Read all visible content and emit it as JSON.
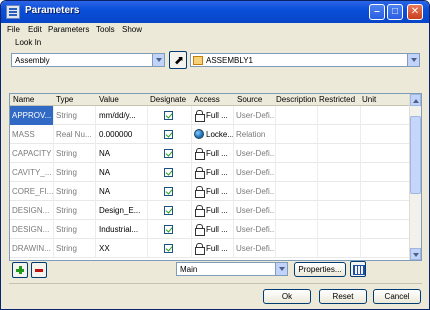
{
  "window": {
    "title": "Parameters"
  },
  "menu": [
    "File",
    "Edit",
    "Parameters",
    "Tools",
    "Show"
  ],
  "lookin": {
    "label": "Look In",
    "type_value": "Assembly",
    "object_value": "ASSEMBLY1"
  },
  "table": {
    "columns": [
      "Name",
      "Type",
      "Value",
      "Designate",
      "Access",
      "Source",
      "Description",
      "Restricted",
      "Unit"
    ],
    "rows": [
      {
        "name": "APPROV...",
        "type": "String",
        "value": "mm/dd/y...",
        "designate": true,
        "access_icon": "lock-icon",
        "access": "Full ...",
        "source": "User-Defi...",
        "description": "",
        "restricted": "",
        "unit": "",
        "selected": true
      },
      {
        "name": "MASS",
        "type": "Real Nu...",
        "value": "0.000000",
        "designate": true,
        "access_icon": "globe-icon",
        "access": "Locke...",
        "source": "Relation",
        "description": "",
        "restricted": "",
        "unit": "",
        "selected": false
      },
      {
        "name": "CAPACITY",
        "type": "String",
        "value": "NA",
        "designate": true,
        "access_icon": "lock-icon",
        "access": "Full ...",
        "source": "User-Defi...",
        "description": "",
        "restricted": "",
        "unit": "",
        "selected": false
      },
      {
        "name": "CAVITY_...",
        "type": "String",
        "value": "NA",
        "designate": true,
        "access_icon": "lock-icon",
        "access": "Full ...",
        "source": "User-Defi...",
        "description": "",
        "restricted": "",
        "unit": "",
        "selected": false
      },
      {
        "name": "CORE_FI...",
        "type": "String",
        "value": "NA",
        "designate": true,
        "access_icon": "lock-icon",
        "access": "Full ...",
        "source": "User-Defi...",
        "description": "",
        "restricted": "",
        "unit": "",
        "selected": false
      },
      {
        "name": "DESIGN...",
        "type": "String",
        "value": "Design_E...",
        "designate": true,
        "access_icon": "lock-icon",
        "access": "Full ...",
        "source": "User-Defi...",
        "description": "",
        "restricted": "",
        "unit": "",
        "selected": false
      },
      {
        "name": "DESIGN...",
        "type": "String",
        "value": "Industrial...",
        "designate": true,
        "access_icon": "lock-icon",
        "access": "Full ...",
        "source": "User-Defi...",
        "description": "",
        "restricted": "",
        "unit": "",
        "selected": false
      },
      {
        "name": "DRAWIN...",
        "type": "String",
        "value": "XX",
        "designate": true,
        "access_icon": "lock-icon",
        "access": "Full ...",
        "source": "User-Defi...",
        "description": "",
        "restricted": "",
        "unit": "",
        "selected": false
      }
    ]
  },
  "bottom": {
    "filter_value": "Main",
    "properties_label": "Properties..."
  },
  "footer": {
    "ok_label": "Ok",
    "reset_label": "Reset",
    "cancel_label": "Cancel"
  },
  "colors": {
    "titlebar": "#0a4fd8",
    "selection": "#316ac5"
  }
}
